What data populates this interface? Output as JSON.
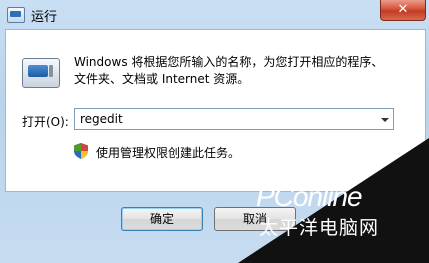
{
  "window": {
    "title": "运行",
    "close_symbol": "✕",
    "app_icon": "run-app-icon"
  },
  "dialog": {
    "icon": "run-dialog-icon",
    "description_line1": "Windows 将根据您所输入的名称，为您打开相应的程序、",
    "description_line2": "文件夹、文档或 Internet 资源。",
    "open_label": "打开(O):",
    "open_value": "regedit",
    "admin_icon": "uac-shield-icon",
    "admin_note": "使用管理权限创建此任务。"
  },
  "buttons": {
    "ok_label": "确定",
    "cancel_label": "取消"
  },
  "watermark": {
    "brand": "PConline",
    "subtitle": "太平洋电脑网"
  },
  "colors": {
    "close_red": "#c23a22",
    "frame_blue": "#b9d3ec",
    "overlay_black": "#111111"
  }
}
